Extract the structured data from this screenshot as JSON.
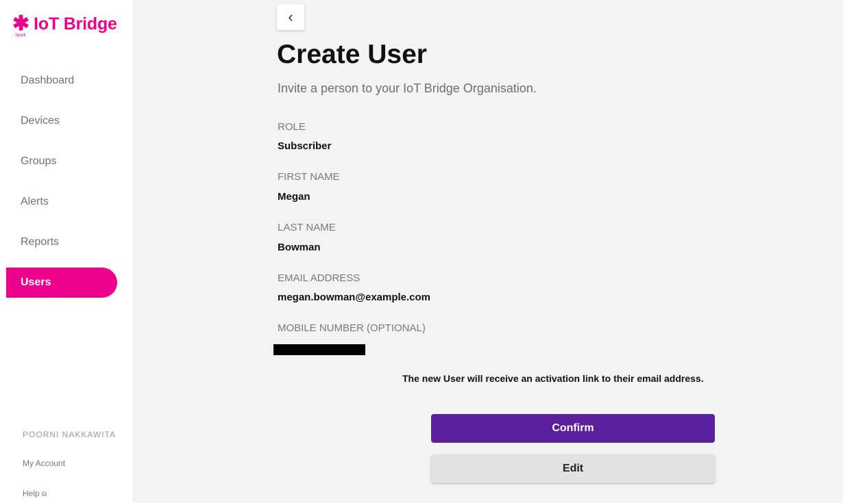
{
  "brand": {
    "name": "IoT Bridge",
    "sub": "Spark",
    "color": "#ec008c"
  },
  "sidebar": {
    "items": [
      {
        "label": "Dashboard",
        "active": false
      },
      {
        "label": "Devices",
        "active": false
      },
      {
        "label": "Groups",
        "active": false
      },
      {
        "label": "Alerts",
        "active": false
      },
      {
        "label": "Reports",
        "active": false
      },
      {
        "label": "Users",
        "active": true
      }
    ],
    "account_name": "POORNI NAKKAWITA",
    "my_account": "My Account",
    "help": "Help",
    "help_icon": "⧉"
  },
  "main": {
    "back_glyph": "‹",
    "title": "Create User",
    "subtitle": "Invite a person to your IoT Bridge Organisation.",
    "fields": [
      {
        "label": "ROLE",
        "value": "Subscriber"
      },
      {
        "label": "FIRST NAME",
        "value": "Megan"
      },
      {
        "label": "LAST NAME",
        "value": "Bowman"
      },
      {
        "label": "EMAIL ADDRESS",
        "value": "megan.bowman@example.com"
      },
      {
        "label": "MOBILE NUMBER (OPTIONAL)",
        "value": ""
      }
    ],
    "info": "The new User will receive an activation link to their email address.",
    "confirm_label": "Confirm",
    "edit_label": "Edit"
  },
  "colors": {
    "accent": "#ec008c",
    "primary_button": "#5b1f9e",
    "secondary_button": "#e2e2e2"
  }
}
